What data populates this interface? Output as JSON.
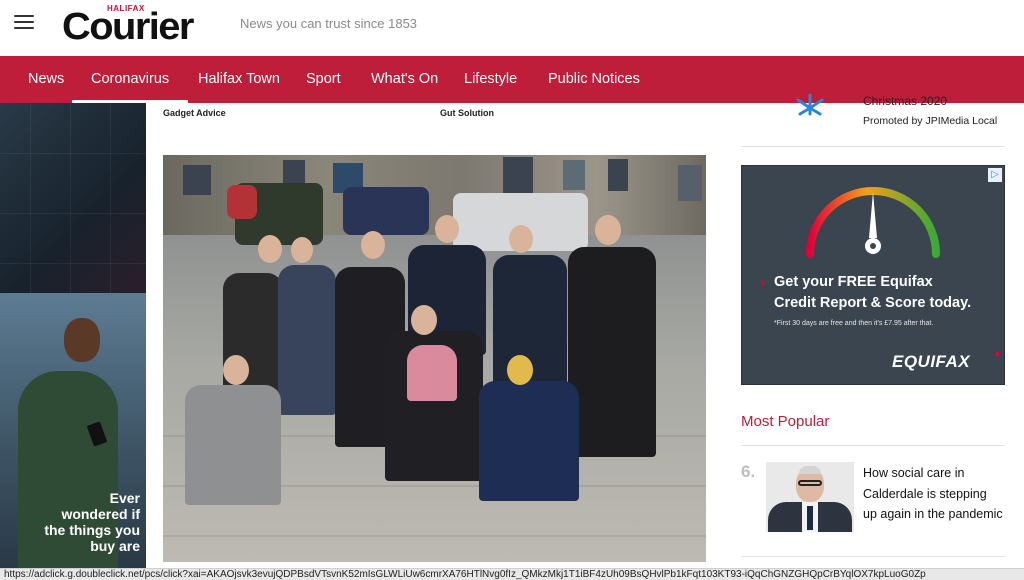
{
  "header": {
    "menu_icon": "hamburger-icon",
    "logo_small": "HALIFAX",
    "logo_main": "Courier",
    "tagline": "News you can trust since 1853"
  },
  "nav": {
    "items": [
      {
        "label": "News"
      },
      {
        "label": "Coronavirus"
      },
      {
        "label": "Halifax Town"
      },
      {
        "label": "Sport"
      },
      {
        "label": "What's On"
      },
      {
        "label": "Lifestyle"
      },
      {
        "label": "Public Notices"
      }
    ],
    "active": "Coronavirus"
  },
  "left_ad": {
    "text": "Ever wondered if the things you buy are"
  },
  "article": {
    "link_labels": [
      "Gadget Advice",
      "Gut Solution"
    ],
    "photo_icon": "group-photo"
  },
  "sidebar": {
    "promo": {
      "title": "Christmas 2020",
      "promoted_by": "Promoted by JPIMedia Local",
      "icon": "snowflake-icon"
    },
    "equifax_ad": {
      "headline_1": "Get your FREE Equifax",
      "headline_2": "Credit Report & Score today.",
      "fine_print": "*First 30 days are free and then it's £7.95 after that.",
      "logo": "EQUIFAX",
      "adchoices_icon": "adchoices-icon",
      "accent_color": "#e3003a"
    },
    "most_popular": {
      "heading": "Most Popular",
      "items": [
        {
          "rank": "6.",
          "title": "How social care in Calderdale is stepping up again in the pandemic"
        }
      ]
    }
  },
  "status_bar": {
    "url": "https://adclick.g.doubleclick.net/pcs/click?xai=AKAOjsvk3evujQDPBsdVTsvnK52mIsGLWLiUw6cmrXA76HTlNvg0fIz_QMkzMkj1T1iBF4zUh09BsQHvlPb1kFqt103KT93-iQqChGNZGHQpCrBYqlOX7kpLuoG0Zp"
  },
  "colors": {
    "brand_red": "#be1e3a",
    "nav_text": "#ffffff",
    "popular_number": "#bdbdbd"
  }
}
